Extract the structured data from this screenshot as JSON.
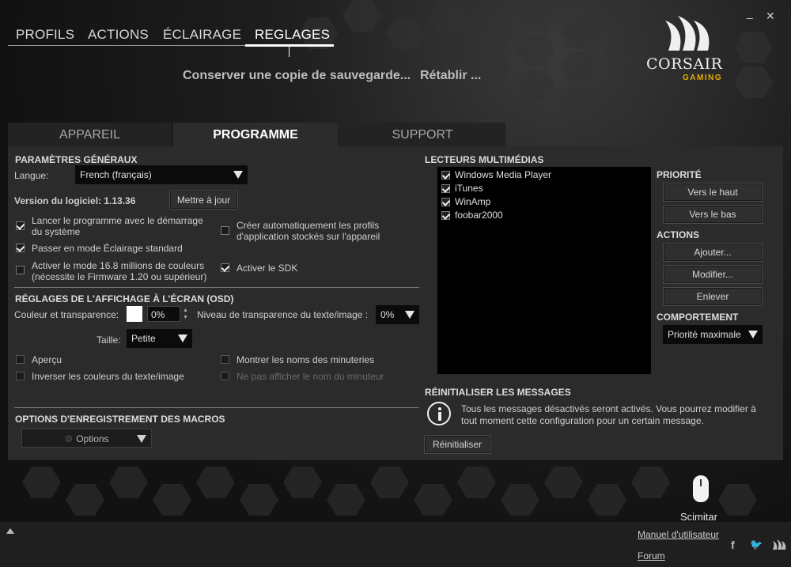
{
  "window": {
    "minimize_label": "_",
    "close_label": "✕"
  },
  "top_tabs": [
    "PROFILS",
    "ACTIONS",
    "ÉCLAIRAGE",
    "REGLAGES"
  ],
  "top_actions": {
    "backup": "Conserver une copie de sauvegarde...",
    "restore": "Rétablir ..."
  },
  "brand": {
    "name": "CORSAIR",
    "sub": "GAMING"
  },
  "sub_tabs": [
    "APPAREIL",
    "PROGRAMME",
    "SUPPORT"
  ],
  "general": {
    "title": "PARAMÈTRES GÉNÉRAUX",
    "language_label": "Langue:",
    "language_value": "French (français)",
    "version_label": "Version du logiciel: 1.13.36",
    "update_button": "Mettre à jour",
    "opt_startup_line1": "Lancer le programme avec le démarrage",
    "opt_startup_line2": "du système",
    "opt_standard_light": "Passer en mode Éclairage standard",
    "opt_16m_line1": "Activer le mode 16.8 millions de couleurs",
    "opt_16m_line2": "(nécessite le Firmware 1.20 ou supérieur)",
    "opt_autoprofile_line1": "Créer automatiquement les profils",
    "opt_autoprofile_line2": "d'application stockés sur l'appareil",
    "opt_sdk": "Activer le SDK"
  },
  "osd": {
    "title": "RÉGLAGES DE L'AFFICHAGE À L'ÉCRAN (OSD)",
    "color_label": "Couleur et transparence:",
    "color_value": "0%",
    "text_transparency_label": "Niveau de transparence du texte/image :",
    "text_transparency_value": "0%",
    "size_label": "Taille:",
    "size_value": "Petite",
    "opt_preview": "Aperçu",
    "opt_invert": "Inverser les couleurs du texte/image",
    "opt_show_timers": "Montrer les noms des minuteries",
    "opt_hide_timer": "Ne pas afficher le nom du minuteur"
  },
  "macros": {
    "title": "OPTIONS D'ENREGISTREMENT DES MACROS",
    "options_button": "Options"
  },
  "media": {
    "title": "LECTEURS MULTIMÉDIAS",
    "players": [
      "Windows Media Player",
      "iTunes",
      "WinAmp",
      "foobar2000"
    ],
    "priority_title": "PRIORITÉ",
    "up_button": "Vers le haut",
    "down_button": "Vers le bas",
    "actions_title": "ACTIONS",
    "add_button": "Ajouter...",
    "edit_button": "Modifier...",
    "remove_button": "Enlever",
    "behavior_title": "COMPORTEMENT",
    "behavior_value": "Priorité maximale"
  },
  "reset": {
    "title": "RÉINITIALISER LES MESSAGES",
    "text_line1": "Tous les messages désactivés seront activés. Vous pourrez modifier à",
    "text_line2": "tout moment cette configuration pour un certain message.",
    "button": "Réinitialiser"
  },
  "device": {
    "name": "Scimitar"
  },
  "footer": {
    "manual": "Manuel d'utilisateur",
    "forum": "Forum"
  },
  "colors": {
    "accent": "#e8b000",
    "panel": "#2b2b2b",
    "background": "#141414"
  }
}
